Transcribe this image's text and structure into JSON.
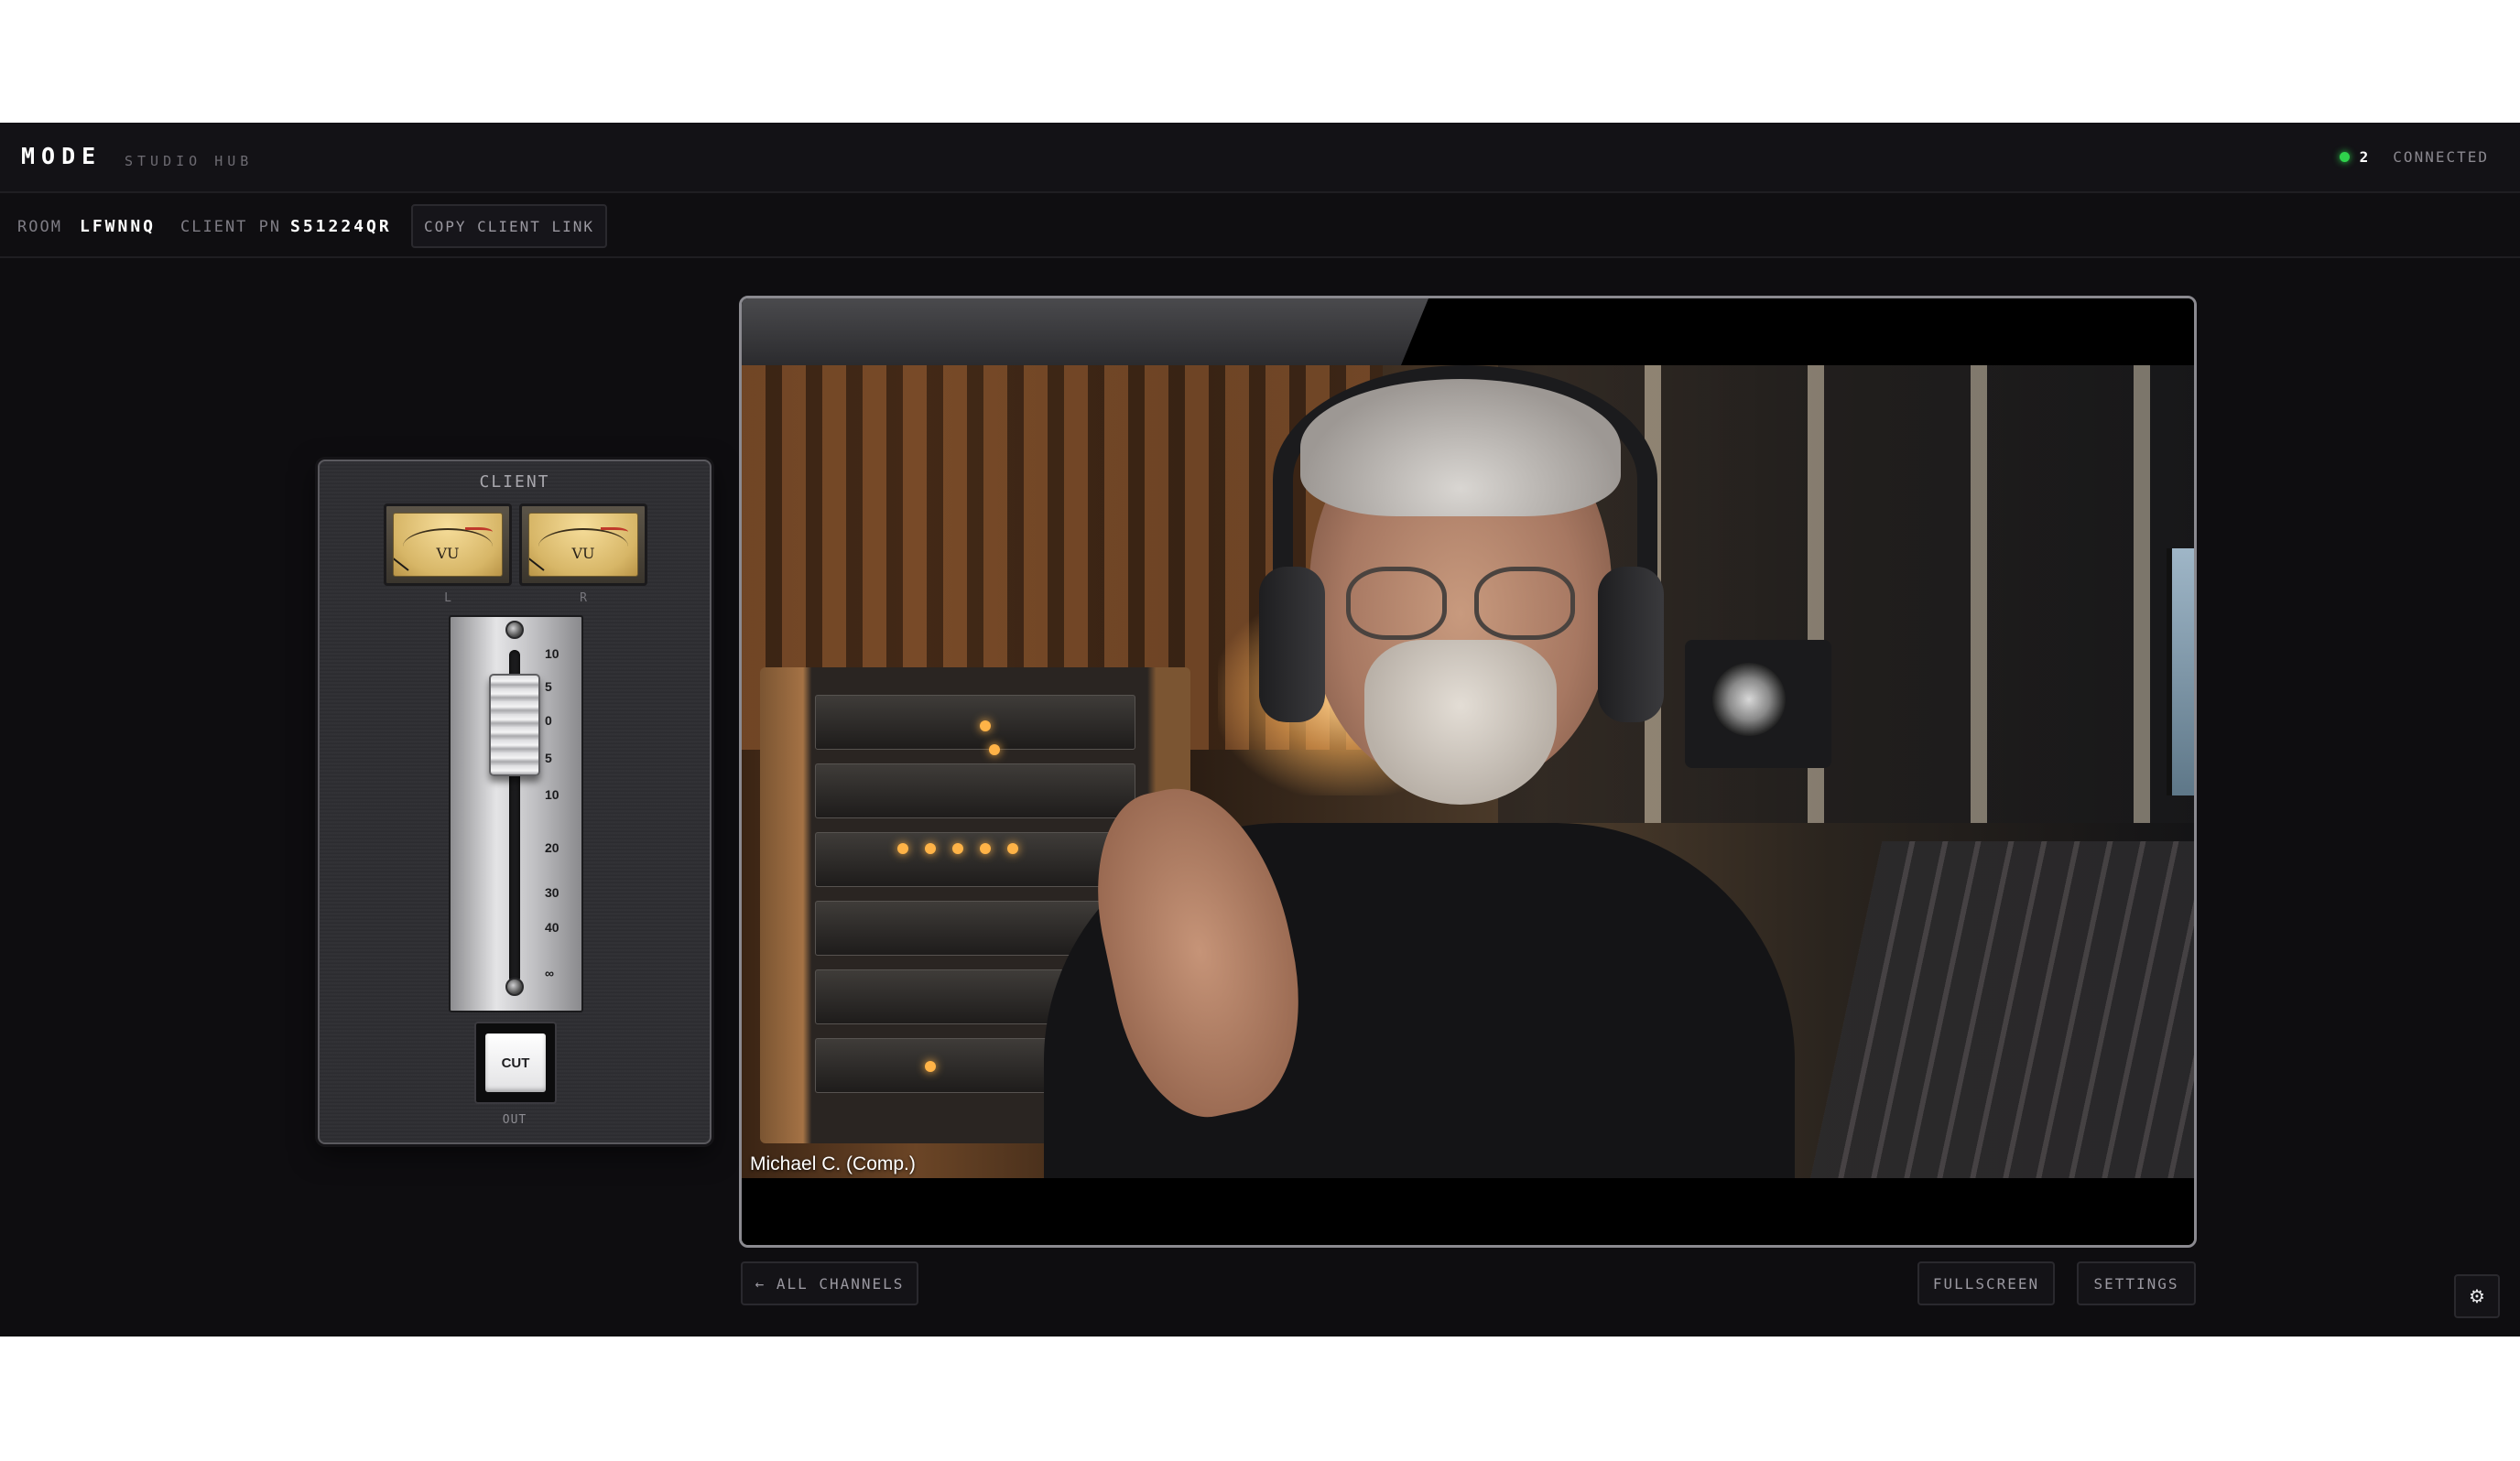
{
  "header": {
    "brand": "MODE",
    "brand_sub": "STUDIO HUB",
    "connected_count": "2",
    "connected_label": "CONNECTED",
    "status_color": "#2fd34c"
  },
  "room_bar": {
    "room_label": "ROOM",
    "room_value": "LFWNNQ",
    "client_pn_label": "CLIENT PN",
    "client_pn_value": "S51224QR",
    "copy_link_label": "COPY CLIENT LINK"
  },
  "channel_strip": {
    "title": "CLIENT",
    "meters": [
      {
        "face_text": "VU",
        "channel": "L"
      },
      {
        "face_text": "VU",
        "channel": "R"
      }
    ],
    "fader_scale": [
      "10",
      "5",
      "0",
      "5",
      "10",
      "20",
      "30",
      "40",
      "∞"
    ],
    "cut_label": "CUT",
    "out_label": "OUT"
  },
  "video": {
    "participant_caption": "Michael C. (Comp.)"
  },
  "controls": {
    "all_channels_label": "← ALL CHANNELS",
    "fullscreen_label": "FULLSCREEN",
    "settings_label": "SETTINGS",
    "gear_icon": "gear-icon",
    "gear_glyph": "⚙"
  }
}
